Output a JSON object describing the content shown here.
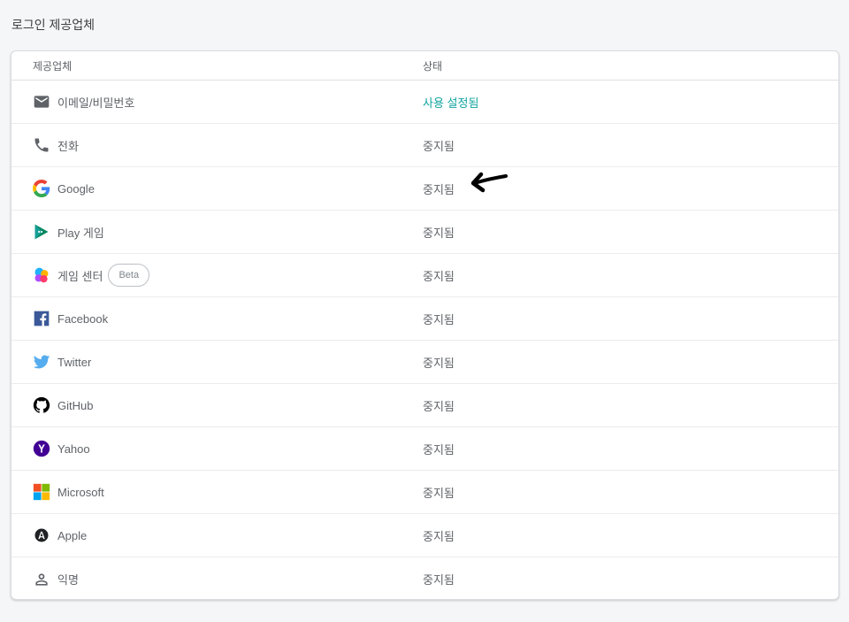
{
  "page": {
    "section_title": "로그인 제공업체"
  },
  "table": {
    "headers": {
      "provider": "제공업체",
      "status": "상태"
    },
    "rows": [
      {
        "icon": "email-icon",
        "label": "이메일/비밀번호",
        "status": "사용 설정됨",
        "enabled": true
      },
      {
        "icon": "phone-icon",
        "label": "전화",
        "status": "중지됨"
      },
      {
        "icon": "google-icon",
        "label": "Google",
        "status": "중지됨"
      },
      {
        "icon": "play-games-icon",
        "label": "Play 게임",
        "status": "중지됨"
      },
      {
        "icon": "game-center-icon",
        "label": "게임 센터",
        "status": "중지됨",
        "badge": "Beta"
      },
      {
        "icon": "facebook-icon",
        "label": "Facebook",
        "status": "중지됨"
      },
      {
        "icon": "twitter-icon",
        "label": "Twitter",
        "status": "중지됨"
      },
      {
        "icon": "github-icon",
        "label": "GitHub",
        "status": "중지됨"
      },
      {
        "icon": "yahoo-icon",
        "label": "Yahoo",
        "status": "중지됨"
      },
      {
        "icon": "microsoft-icon",
        "label": "Microsoft",
        "status": "중지됨"
      },
      {
        "icon": "apple-icon",
        "label": "Apple",
        "status": "중지됨"
      },
      {
        "icon": "anonymous-icon",
        "label": "익명",
        "status": "중지됨"
      }
    ]
  },
  "colors": {
    "enabled": "#12a4a0",
    "disabled": "#5f6368"
  },
  "annotation": {
    "icon": "arrow-left-icon"
  }
}
